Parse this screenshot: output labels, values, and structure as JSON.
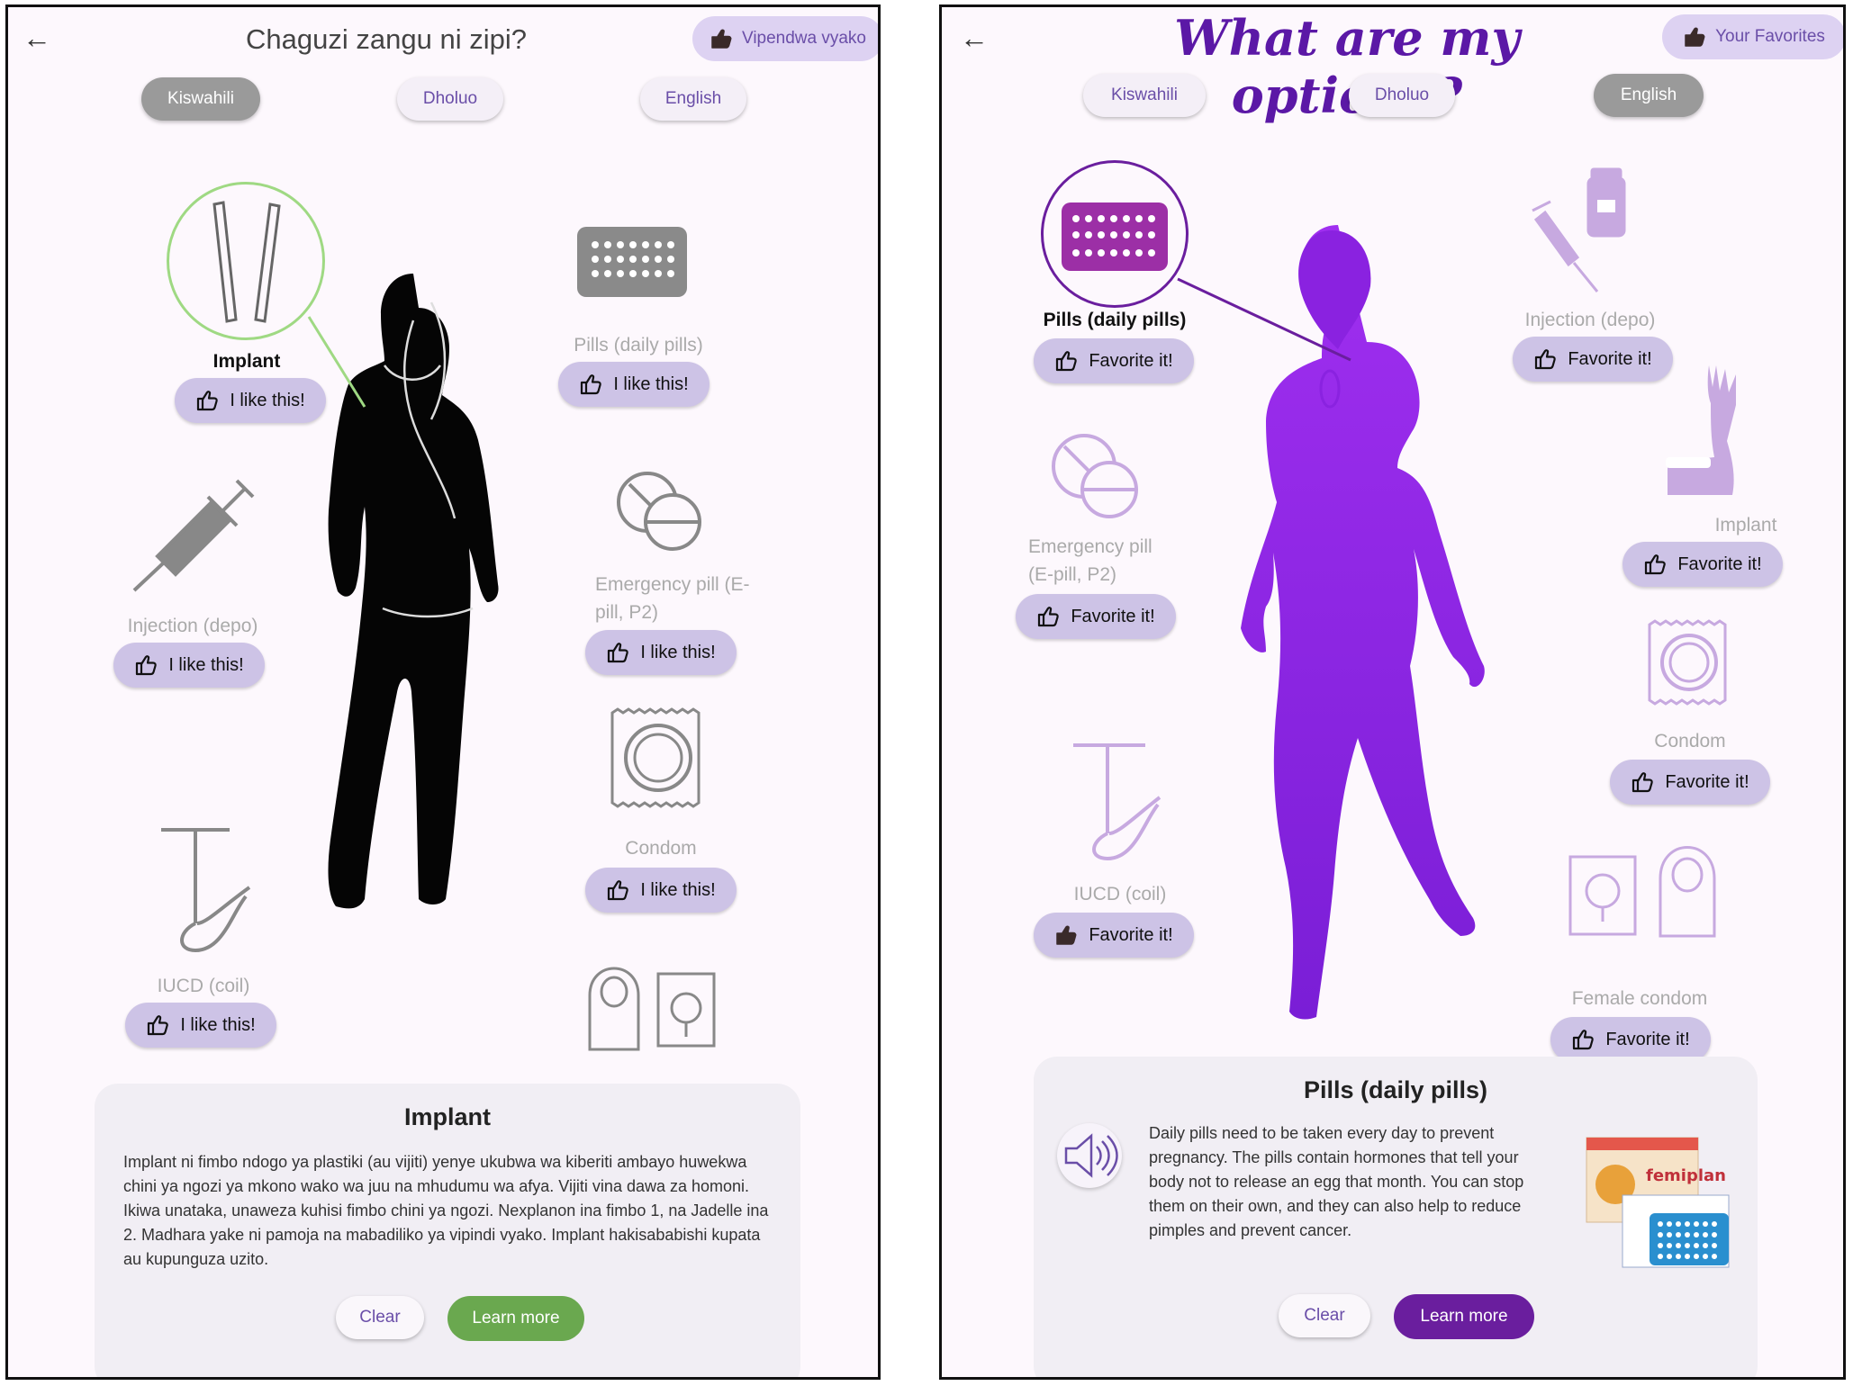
{
  "left": {
    "title": "Chaguzi zangu ni zipi?",
    "favorites_label": "Vipendwa vyako",
    "languages": [
      "Kiswahili",
      "Dholuo",
      "English"
    ],
    "selected_language": "Kiswahili",
    "methods": {
      "implant": "Implant",
      "pills": "Pills (daily pills)",
      "injection": "Injection (depo)",
      "emergency": "Emergency pill (E-pill, P2)",
      "condom": "Condom",
      "iucd": "IUCD (coil)"
    },
    "like_label": "I like this!",
    "selected_method": "Implant",
    "card": {
      "title": "Implant",
      "body": "Implant ni fimbo ndogo ya plastiki (au vijiti) yenye ukubwa wa kiberiti ambayo huwekwa chini ya ngozi ya mkono wako wa juu na mhudumu wa afya. Vijiti vina dawa za homoni. Ikiwa unataka, unaweza kuhisi fimbo chini ya ngozi. Nexplanon ina fimbo 1, na Jadelle ina 2. Madhara yake ni pamoja na mabadiliko ya vipindi vyako. Implant hakisababishi kupata au kupunguza uzito.",
      "clear": "Clear",
      "learn_more": "Learn more"
    },
    "accent_color": "#6aa84f"
  },
  "right": {
    "title": "What are my options?",
    "favorites_label": "Your Favorites",
    "languages": [
      "Kiswahili",
      "Dholuo",
      "English"
    ],
    "selected_language": "English",
    "methods": {
      "pills": "Pills (daily pills)",
      "injection": "Injection (depo)",
      "emergency_line1": "Emergency pill",
      "emergency_line2": "(E-pill, P2)",
      "implant": "Implant",
      "condom": "Condom",
      "iucd": "IUCD (coil)",
      "female_condom": "Female condom"
    },
    "favorite_label": "Favorite it!",
    "selected_method": "Pills (daily pills)",
    "favorited_method": "IUCD (coil)",
    "card": {
      "title": "Pills (daily pills)",
      "body": "Daily pills need to be taken every day to prevent pregnancy. The pills contain hormones that tell your body not to release an egg that month. You can stop them on their own, and they can also help to reduce pimples and prevent cancer.",
      "product_brand": "femiplan",
      "clear": "Clear",
      "learn_more": "Learn more"
    },
    "accent_color": "#6a1e9e"
  }
}
